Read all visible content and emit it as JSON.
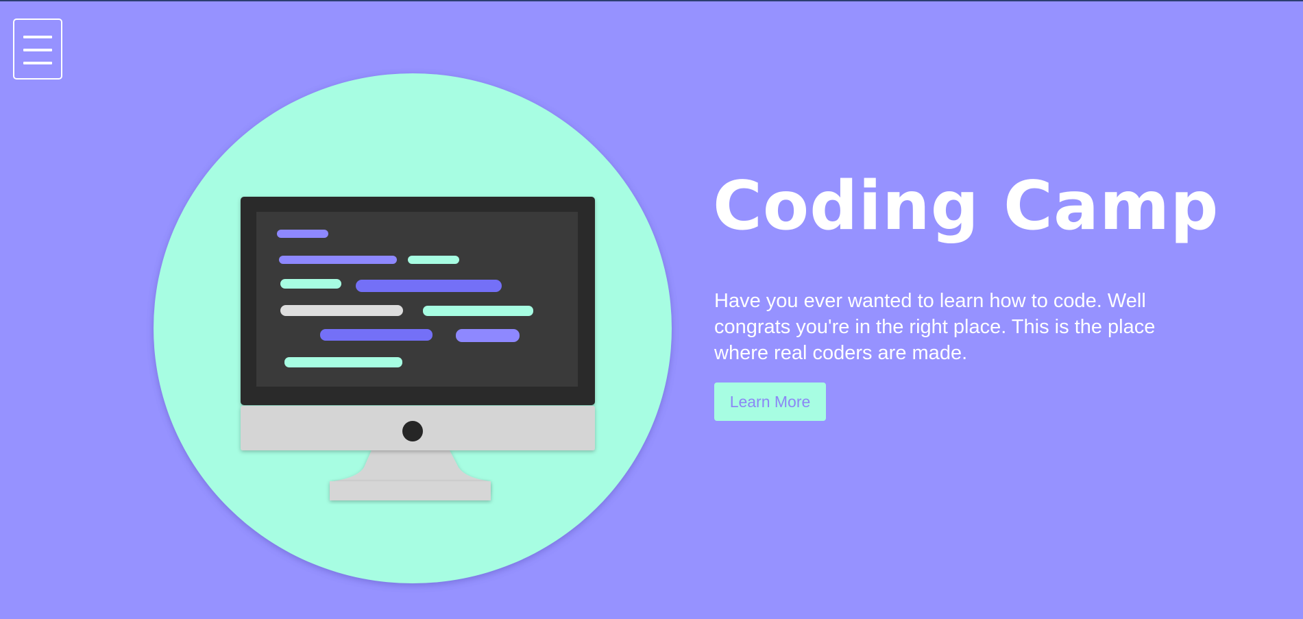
{
  "colors": {
    "background": "#9692ff",
    "accent": "#a7fde2",
    "monitor_frame": "#2a2a2a",
    "screen": "#3a3a3a",
    "monitor_chin": "#d5d5d5",
    "code_purple": "#8e88ff",
    "code_blue": "#7470f7",
    "code_mint": "#a7fde2",
    "code_gray": "#dddddd"
  },
  "nav": {
    "menu_icon": "hamburger-menu-icon"
  },
  "hero": {
    "illustration": "desktop-monitor-with-code-illustration",
    "title": "Coding Camp",
    "description": "Have you ever wanted to learn how to code. Well congrats you're in the right place. This is the place where real coders are made.",
    "cta_label": "Learn More"
  }
}
